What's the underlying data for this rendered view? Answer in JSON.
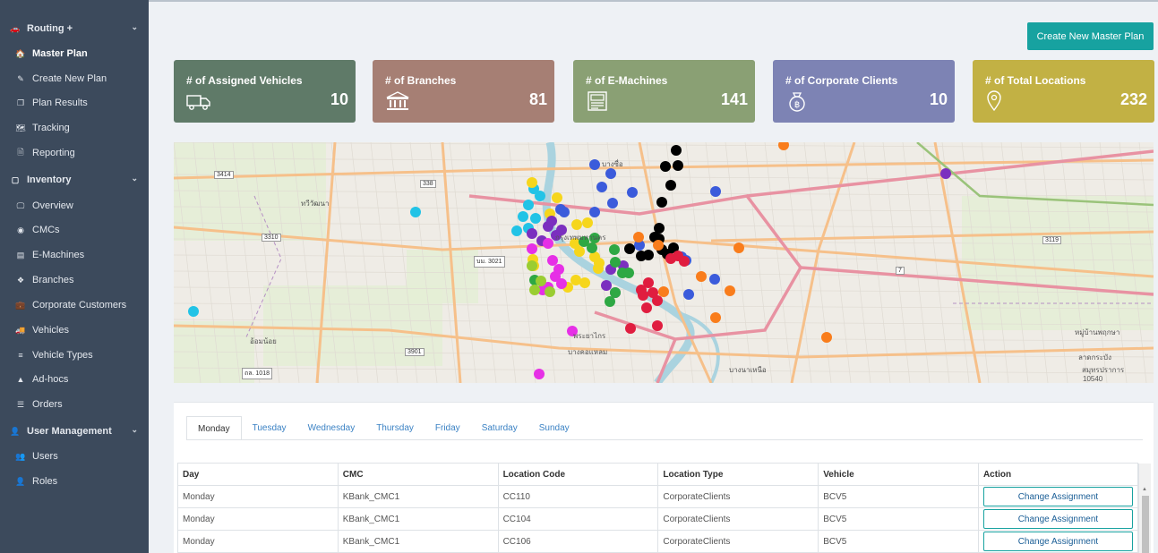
{
  "sidebar": {
    "groups": [
      {
        "label": "Routing +",
        "icon": "car-icon"
      },
      {
        "label": "Inventory",
        "icon": "box-icon"
      },
      {
        "label": "User Management",
        "icon": "user-icon"
      }
    ],
    "items": [
      {
        "label": "Master Plan",
        "icon": "home-icon",
        "active": true
      },
      {
        "label": "Create New Plan",
        "icon": "edit-icon"
      },
      {
        "label": "Plan Results",
        "icon": "copy-icon"
      },
      {
        "label": "Tracking",
        "icon": "map-icon"
      },
      {
        "label": "Reporting",
        "icon": "file-icon"
      },
      {
        "label": "Overview",
        "icon": "monitor-icon"
      },
      {
        "label": "CMCs",
        "icon": "globe-icon"
      },
      {
        "label": "E-Machines",
        "icon": "card-icon"
      },
      {
        "label": "Branches",
        "icon": "cube-icon"
      },
      {
        "label": "Corporate Customers",
        "icon": "briefcase-icon"
      },
      {
        "label": "Vehicles",
        "icon": "truck-icon"
      },
      {
        "label": "Vehicle Types",
        "icon": "sliders-icon"
      },
      {
        "label": "Ad-hocs",
        "icon": "warning-icon"
      },
      {
        "label": "Orders",
        "icon": "list-icon"
      },
      {
        "label": "Users",
        "icon": "users-icon"
      },
      {
        "label": "Roles",
        "icon": "user-plus-icon"
      }
    ]
  },
  "header": {
    "create_button": "Create New Master Plan"
  },
  "cards": [
    {
      "title": "# of Assigned Vehicles",
      "value": "10",
      "icon": "truck-icon",
      "color": "#5f7a68"
    },
    {
      "title": "# of Branches",
      "value": "81",
      "icon": "bank-icon",
      "color": "#a67f74"
    },
    {
      "title": "# of E-Machines",
      "value": "141",
      "icon": "atm-icon",
      "color": "#8aa074"
    },
    {
      "title": "# of Corporate Clients",
      "value": "10",
      "icon": "money-bag-icon",
      "color": "#7d83b4"
    },
    {
      "title": "# of Total Locations",
      "value": "232",
      "icon": "location-pin-icon",
      "color": "#c2b144"
    }
  ],
  "map": {
    "labels": [
      "บางซื่อ",
      "กรุงเทพมหานคร",
      "พระยาไกร",
      "บางคอแหลม",
      "ทวีวัฒนา",
      "อ้อมน้อย",
      "หมู่บ้านพฤกษา",
      "ลาดกระบัง",
      "สมุทรปราการ",
      "10540",
      "บางนาเหนือ"
    ],
    "shields": [
      "3414",
      "338",
      "3310",
      "3119",
      "3901",
      "ถล. 1018",
      "บม. 3021",
      "7"
    ],
    "marker_colors": [
      "#3b5bdb",
      "#000000",
      "#f97d1c",
      "#22c3e6",
      "#f6d61c",
      "#7b2fbf",
      "#e630e6",
      "#2ea844",
      "#e01d3f",
      "#9acd32"
    ]
  },
  "schedule": {
    "tabs": [
      "Monday",
      "Tuesday",
      "Wednesday",
      "Thursday",
      "Friday",
      "Saturday",
      "Sunday"
    ],
    "active_tab": "Monday",
    "columns": [
      "Day",
      "CMC",
      "Location Code",
      "Location Type",
      "Vehicle",
      "Action"
    ],
    "rows": [
      {
        "day": "Monday",
        "cmc": "KBank_CMC1",
        "code": "CC110",
        "type": "CorporateClients",
        "vehicle": "BCV5",
        "action": "Change Assignment"
      },
      {
        "day": "Monday",
        "cmc": "KBank_CMC1",
        "code": "CC104",
        "type": "CorporateClients",
        "vehicle": "BCV5",
        "action": "Change Assignment"
      },
      {
        "day": "Monday",
        "cmc": "KBank_CMC1",
        "code": "CC106",
        "type": "CorporateClients",
        "vehicle": "BCV5",
        "action": "Change Assignment"
      }
    ]
  }
}
